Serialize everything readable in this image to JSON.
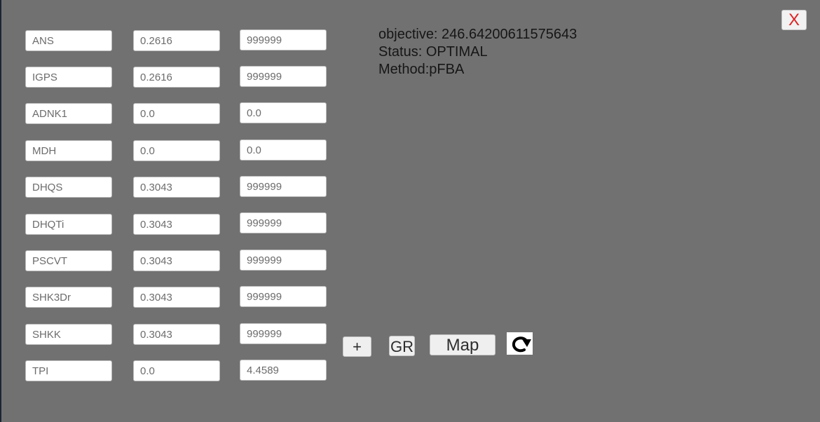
{
  "close_label": "X",
  "results": {
    "objective": "objective: 246.64200611575643",
    "status": "Status: OPTIMAL",
    "method": "Method:pFBA"
  },
  "rows": [
    {
      "name": "ANS",
      "lower": "0.2616",
      "upper": "999999"
    },
    {
      "name": "IGPS",
      "lower": "0.2616",
      "upper": "999999"
    },
    {
      "name": "ADNK1",
      "lower": "0.0",
      "upper": "0.0"
    },
    {
      "name": "MDH",
      "lower": "0.0",
      "upper": "0.0"
    },
    {
      "name": "DHQS",
      "lower": "0.3043",
      "upper": "999999"
    },
    {
      "name": "DHQTi",
      "lower": "0.3043",
      "upper": "999999"
    },
    {
      "name": "PSCVT",
      "lower": "0.3043",
      "upper": "999999"
    },
    {
      "name": "SHK3Dr",
      "lower": "0.3043",
      "upper": "999999"
    },
    {
      "name": "SHKK",
      "lower": "0.3043",
      "upper": "999999"
    },
    {
      "name": "TPI",
      "lower": "0.0",
      "upper": "4.4589"
    }
  ],
  "toolbar": {
    "add_label": "+",
    "gr_label": "GR",
    "map_label": "Map",
    "refresh_icon": "refresh-icon"
  },
  "colors": {
    "background": "#717171",
    "close_text": "#e02222"
  }
}
